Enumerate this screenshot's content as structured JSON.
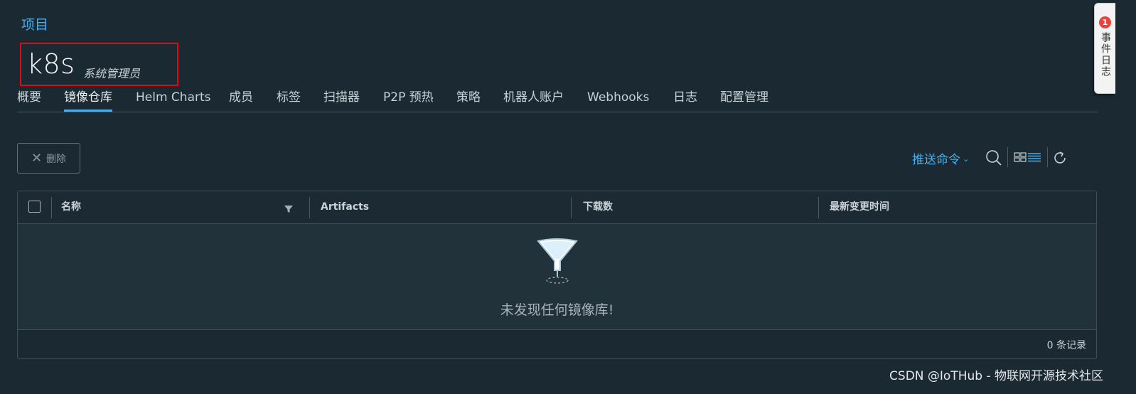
{
  "breadcrumb": "项目",
  "project": {
    "name": "k8s",
    "role": "系统管理员"
  },
  "tabs": [
    {
      "label": "概要"
    },
    {
      "label": "镜像仓库",
      "active": true
    },
    {
      "label": "Helm Charts"
    },
    {
      "label": "成员"
    },
    {
      "label": "标签"
    },
    {
      "label": "扫描器"
    },
    {
      "label": "P2P 预热"
    },
    {
      "label": "策略"
    },
    {
      "label": "机器人账户"
    },
    {
      "label": "Webhooks"
    },
    {
      "label": "日志"
    },
    {
      "label": "配置管理"
    }
  ],
  "toolbar": {
    "delete_label": "删除",
    "push_command_label": "推送命令",
    "icons": [
      "search-icon",
      "card-view-icon",
      "list-view-icon",
      "refresh-icon"
    ]
  },
  "table": {
    "columns": [
      "名称",
      "Artifacts",
      "下载数",
      "最新变更时间"
    ],
    "empty_message": "未发现任何镜像库!",
    "footer_count": "0 条记录"
  },
  "side_widget": {
    "badge": "1",
    "label": "事件日志"
  },
  "watermark": "CSDN @IoTHub - 物联网开源技术社区",
  "colors": {
    "background": "#1b2a32",
    "accent": "#49aeea",
    "highlight_box": "#d60f16"
  }
}
